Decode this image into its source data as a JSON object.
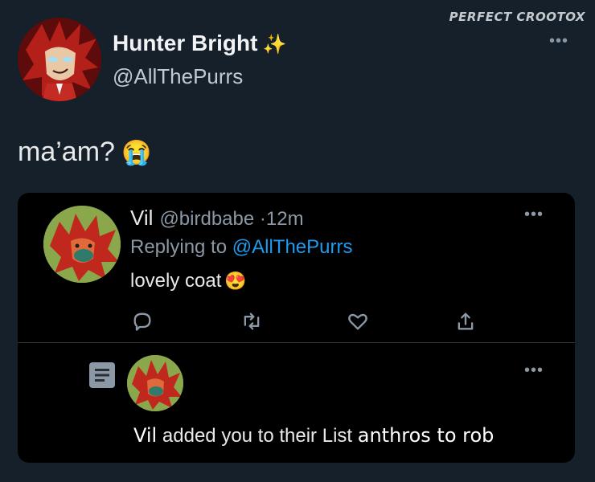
{
  "watermark": "PERFECT CROOTOX",
  "tweet": {
    "author_name": "Hunter Bright",
    "author_name_emoji": "✨",
    "author_handle": "@AllThePurrs",
    "text": "ma’am?",
    "text_emoji": "😭"
  },
  "reply": {
    "name": "Vil",
    "handle": "@birdbabe",
    "separator": "·",
    "time": "12m",
    "replying_to_label": "Replying to",
    "replying_to_handle": "@AllThePurrs",
    "text": "lovely coat",
    "text_emoji": "😍"
  },
  "notification": {
    "actor": "Vil",
    "middle_text": "added you to their List",
    "list_name": "anthros to rob"
  },
  "colors": {
    "background": "#15202b",
    "card_background": "#000000",
    "link": "#1d9bf0",
    "secondary_text": "#8b98a5"
  }
}
